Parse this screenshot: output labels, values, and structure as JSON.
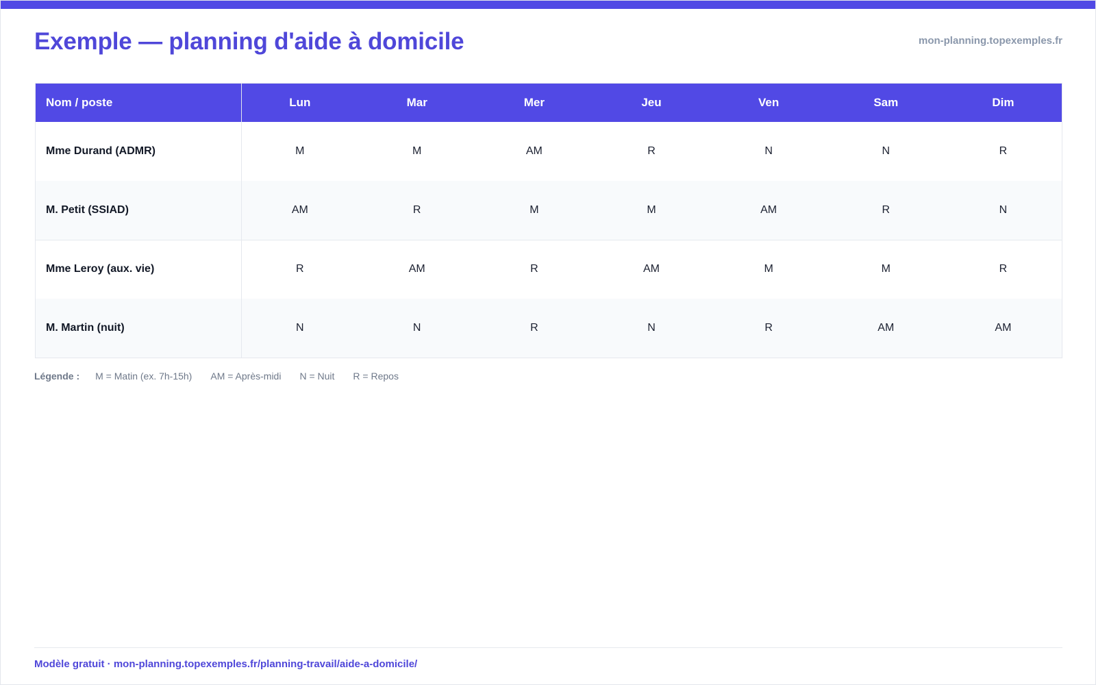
{
  "header": {
    "title": "Exemple — planning d'aide à domicile",
    "site": "mon-planning.topexemples.fr"
  },
  "table": {
    "name_header": "Nom / poste",
    "days": [
      "Lun",
      "Mar",
      "Mer",
      "Jeu",
      "Ven",
      "Sam",
      "Dim"
    ],
    "rows": [
      {
        "name": "Mme Durand (ADMR)",
        "shifts": [
          "M",
          "M",
          "AM",
          "R",
          "N",
          "N",
          "R"
        ]
      },
      {
        "name": "M. Petit (SSIAD)",
        "shifts": [
          "AM",
          "R",
          "M",
          "M",
          "AM",
          "R",
          "N"
        ]
      },
      {
        "name": "Mme Leroy (aux. vie)",
        "shifts": [
          "R",
          "AM",
          "R",
          "AM",
          "M",
          "M",
          "R"
        ]
      },
      {
        "name": "M. Martin (nuit)",
        "shifts": [
          "N",
          "N",
          "R",
          "N",
          "R",
          "AM",
          "AM"
        ]
      }
    ]
  },
  "legend": {
    "title": "Légende :",
    "items": [
      "M = Matin (ex. 7h-15h)",
      "AM = Après-midi",
      "N = Nuit",
      "R = Repos"
    ]
  },
  "footer": {
    "text": "Modèle gratuit · mon-planning.topexemples.fr/planning-travail/aide-a-domicile/"
  },
  "colors": {
    "accent": "#5149e5",
    "title": "#4f47d9",
    "muted": "#8a97ab"
  }
}
